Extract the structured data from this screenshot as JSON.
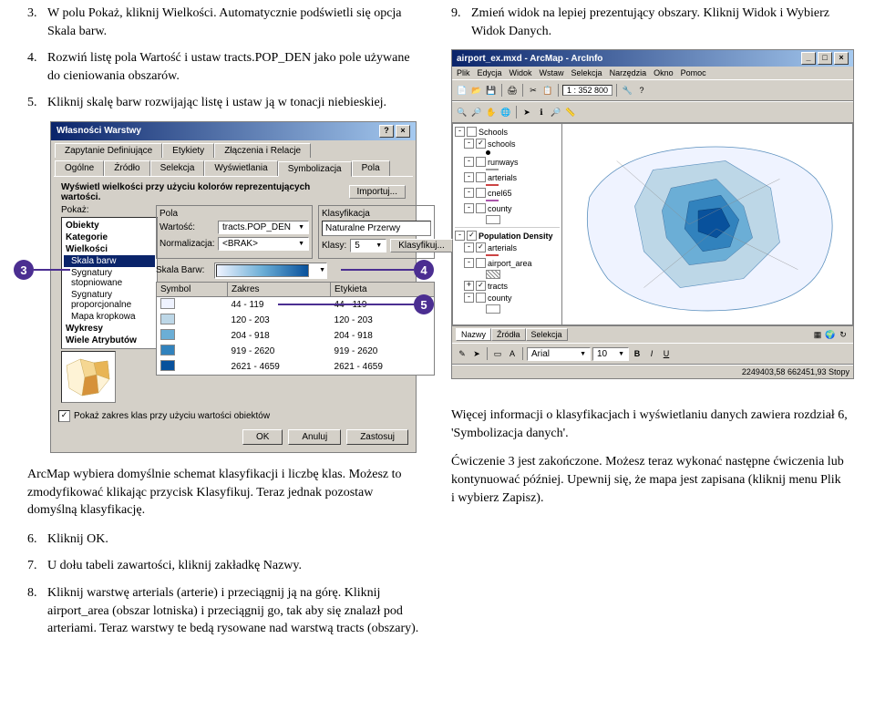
{
  "left": {
    "steps_a": [
      {
        "n": "3.",
        "t": "W polu Pokaż, kliknij Wielkości. Automatycznie podświetli się opcja Skala barw."
      },
      {
        "n": "4.",
        "t": "Rozwiń listę pola Wartość i ustaw tracts.POP_DEN jako pole używane do cieniowania obszarów."
      },
      {
        "n": "5.",
        "t": "Kliknij skalę barw rozwijając listę i ustaw ją w tonacji niebieskiej."
      }
    ],
    "para1": "ArcMap wybiera domyślnie schemat klasyfikacji i liczbę klas. Możesz to zmodyfikować klikając przycisk Klasyfikuj. Teraz jednak pozostaw domyślną klasyfikację.",
    "steps_b": [
      {
        "n": "6.",
        "t": "Kliknij OK."
      },
      {
        "n": "7.",
        "t": "U dołu tabeli zawartości, kliknij zakładkę Nazwy."
      },
      {
        "n": "8.",
        "t": "Kliknij warstwę arterials (arterie) i przeciągnij ją na górę. Kliknij airport_area (obszar lotniska) i przeciągnij go, tak aby się znalazł pod arteriami. Teraz warstwy te bedą rysowane nad warstwą tracts (obszary)."
      }
    ]
  },
  "dialog": {
    "title": "Własności Warstwy",
    "tabs_row1": [
      "Zapytanie Definiujące",
      "Etykiety",
      "Złączenia i Relacje"
    ],
    "tabs_row2": [
      "Ogólne",
      "Źródło",
      "Selekcja",
      "Wyświetlania",
      "Symbolizacja",
      "Pola"
    ],
    "heading": "Wyświetl wielkości przy użyciu kolorów reprezentujących wartości.",
    "import": "Importuj...",
    "show_label": "Pokaż:",
    "show_items": [
      {
        "t": "Obiekty",
        "b": true
      },
      {
        "t": "Kategorie",
        "b": true
      },
      {
        "t": "Wielkości",
        "b": true
      },
      {
        "t": "Skala barw",
        "b": false,
        "i": true,
        "sel": true
      },
      {
        "t": "Sygnatury stopniowane",
        "b": false,
        "i": true
      },
      {
        "t": "Sygnatury proporcjonalne",
        "b": false,
        "i": true
      },
      {
        "t": "Mapa kropkowa",
        "b": false,
        "i": true
      },
      {
        "t": "Wykresy",
        "b": true
      },
      {
        "t": "Wiele Atrybutów",
        "b": true
      }
    ],
    "fields_label": "Pola",
    "value_label": "Wartość:",
    "value_val": "tracts.POP_DEN",
    "norm_label": "Normalizacja:",
    "norm_val": "<BRAK>",
    "class_label": "Klasyfikacja",
    "class_method": "Naturalne Przerwy",
    "classes_label": "Klasy:",
    "classes_val": "5",
    "classify_btn": "Klasyfikuj...",
    "ramp_label": "Skala Barw:",
    "headers": [
      "Symbol",
      "Zakres",
      "Etykieta"
    ],
    "rows": [
      {
        "c": "#eff3ff",
        "r": "44 - 119",
        "l": "44 - 119"
      },
      {
        "c": "#bdd7e7",
        "r": "120 - 203",
        "l": "120 - 203"
      },
      {
        "c": "#6baed6",
        "r": "204 - 918",
        "l": "204 - 918"
      },
      {
        "c": "#3182bd",
        "r": "919 - 2620",
        "l": "919 - 2620"
      },
      {
        "c": "#08519c",
        "r": "2621 - 4659",
        "l": "2621 - 4659"
      }
    ],
    "show_classes_chk": "Pokaż zakres klas przy użyciu wartości obiektów",
    "ok": "OK",
    "cancel": "Anuluj",
    "apply": "Zastosuj"
  },
  "callouts": {
    "c3": "3",
    "c4": "4",
    "c5": "5"
  },
  "right": {
    "step9_n": "9.",
    "step9_t": "Zmień widok na lepiej prezentujący obszary. Kliknij Widok i Wybierz Widok Danych.",
    "para2": "Więcej informacji o klasyfikacjach i wyświetlaniu danych zawiera rozdział 6, 'Symbolizacja danych'.",
    "para3": "Ćwiczenie 3 jest zakończone. Możesz teraz wykonać następne ćwiczenia lub kontynuować później. Upewnij się, że mapa jest zapisana (kliknij menu Plik i wybierz Zapisz)."
  },
  "arcmap": {
    "title": "airport_ex.mxd - ArcMap - ArcInfo",
    "menus": [
      "Plik",
      "Edycja",
      "Widok",
      "Wstaw",
      "Selekcja",
      "Narzędzia",
      "Okno",
      "Pomoc"
    ],
    "scale": "1 : 352 800",
    "toc": [
      {
        "pm": "-",
        "cb": "",
        "t": "Schools"
      },
      {
        "pm": "-",
        "cb": "✓",
        "t": "schools",
        "i": 1
      },
      {
        "sym": "dot",
        "i": 3
      },
      {
        "pm": "-",
        "cb": "",
        "t": "runways",
        "i": 1
      },
      {
        "sym": "line-gray",
        "i": 3
      },
      {
        "pm": "-",
        "cb": "",
        "t": "arterials",
        "i": 1
      },
      {
        "sym": "line-red",
        "i": 3
      },
      {
        "pm": "-",
        "cb": "",
        "t": "cnel65",
        "i": 1
      },
      {
        "sym": "line-purple",
        "i": 3
      },
      {
        "pm": "-",
        "cb": "",
        "t": "county",
        "i": 1
      },
      {
        "sym": "box-gray",
        "i": 3
      },
      {
        "sep": true
      },
      {
        "pm": "-",
        "cb": "✓",
        "t": "Population Density",
        "b": true
      },
      {
        "pm": "-",
        "cb": "✓",
        "t": "arterials",
        "i": 1
      },
      {
        "sym": "line-red",
        "i": 3
      },
      {
        "pm": "-",
        "cb": "",
        "t": "airport_area",
        "i": 1
      },
      {
        "sym": "box-cross",
        "i": 3
      },
      {
        "pm": "+",
        "cb": "✓",
        "t": "tracts",
        "i": 1
      },
      {
        "pm": "-",
        "cb": "",
        "t": "county",
        "i": 1
      },
      {
        "sym": "box-gray",
        "i": 3
      }
    ],
    "bottom_tabs": [
      "Nazwy",
      "Źródła",
      "Selekcja"
    ],
    "toolbar2": [
      "Arial",
      "10"
    ],
    "statusbar": "2249403,58  662451,93 Stopy"
  }
}
